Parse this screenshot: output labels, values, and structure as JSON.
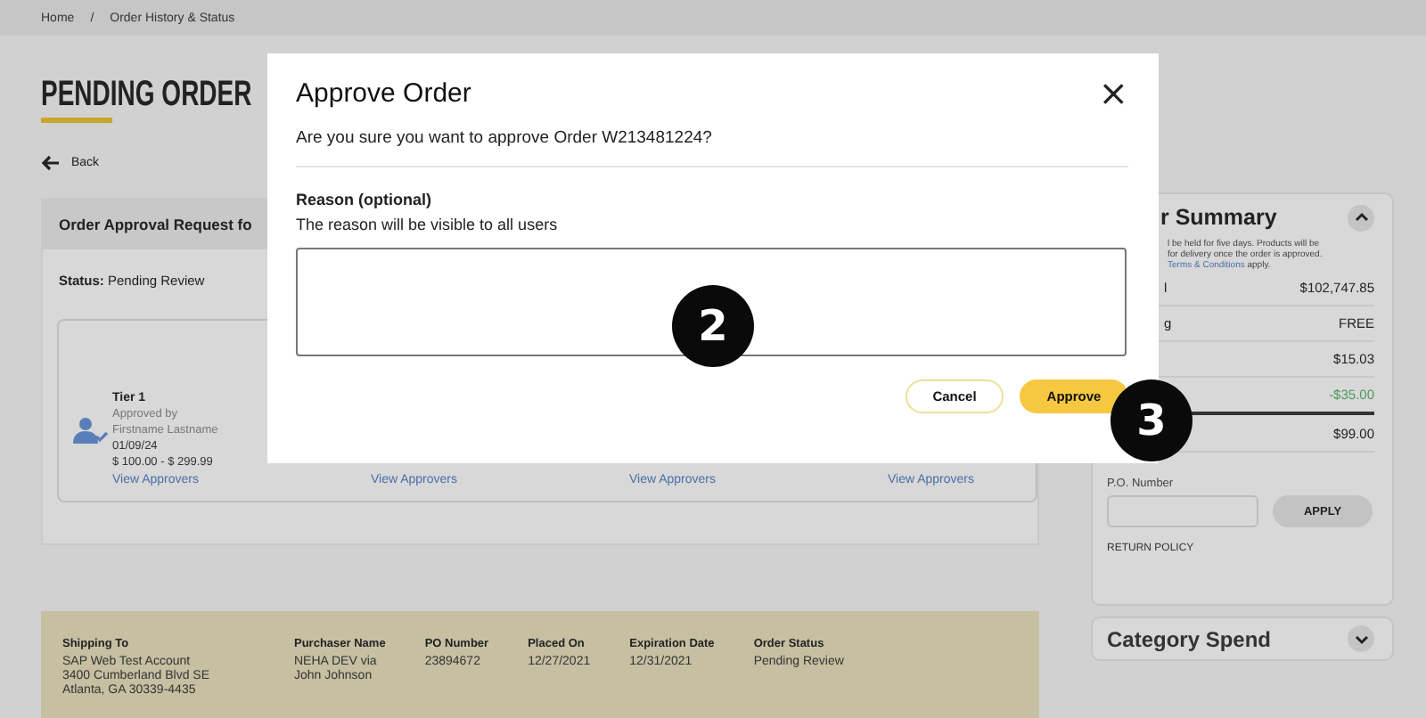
{
  "breadcrumb": [
    {
      "text": "Home"
    },
    {
      "text": "/"
    },
    {
      "text": "Order History & Status"
    }
  ],
  "page_title": "PENDING ORDER",
  "back_link": "Back",
  "approval_card": {
    "title": "Order Approval Request fo",
    "status_label": "Status:",
    "status_value": "Pending Review",
    "tiers": [
      {
        "name": "Tier 1",
        "approved_by": "Approved by",
        "approver": "Firstname Lastname",
        "date": "01/09/24",
        "range": "$ 100.00 - $ 299.99",
        "link": "View Approvers"
      },
      {
        "link": "View Approvers"
      },
      {
        "link": "View Approvers"
      },
      {
        "link": "View Approvers"
      }
    ]
  },
  "order_info": [
    {
      "label": "Shipping To",
      "lines": [
        "SAP Web Test Account",
        "3400 Cumberland Blvd SE",
        "Atlanta, GA 30339-4435"
      ]
    },
    {
      "label": "Purchaser Name",
      "lines": [
        "NEHA DEV via",
        "John Johnson"
      ]
    },
    {
      "label": "PO Number",
      "lines": [
        "23894672"
      ]
    },
    {
      "label": "Placed On",
      "lines": [
        "12/27/2021"
      ]
    },
    {
      "label": "Expiration Date",
      "lines": [
        "12/31/2021"
      ]
    },
    {
      "label": "Order Status",
      "lines": [
        "Pending Review"
      ]
    }
  ],
  "summary": {
    "title": "r Summary",
    "expanded": true,
    "note_lines": [
      "l be held for five days. Products will be",
      "for delivery once the order is approved."
    ],
    "note_link": "Terms & Conditions",
    "note_tail": "apply.",
    "rows": [
      {
        "label": "l",
        "value": "$102,747.85",
        "kind": "normal"
      },
      {
        "label": "g",
        "value": "FREE",
        "kind": "normal"
      },
      {
        "value": "$15.03",
        "kind": "normal"
      },
      {
        "value": "-$35.00",
        "kind": "discount"
      },
      {
        "value": "$99.00",
        "kind": "total"
      }
    ],
    "po_label": "P.O. Number",
    "apply": "APPLY",
    "return_policy": "RETURN POLICY"
  },
  "category_spend": {
    "title": "Category Spend",
    "expanded": false
  },
  "modal": {
    "title": "Approve Order",
    "close": "×",
    "question": "Are you sure you want to approve Order W213481224?",
    "reason_label": "Reason (optional)",
    "reason_help": "The reason will be visible to all users",
    "buttons": [
      {
        "label": "Cancel",
        "kind": "secondary"
      },
      {
        "label": "Approve",
        "kind": "primary"
      }
    ]
  },
  "callouts": [
    {
      "label": "2",
      "kind": "field"
    },
    {
      "label": "3",
      "kind": "button"
    }
  ]
}
